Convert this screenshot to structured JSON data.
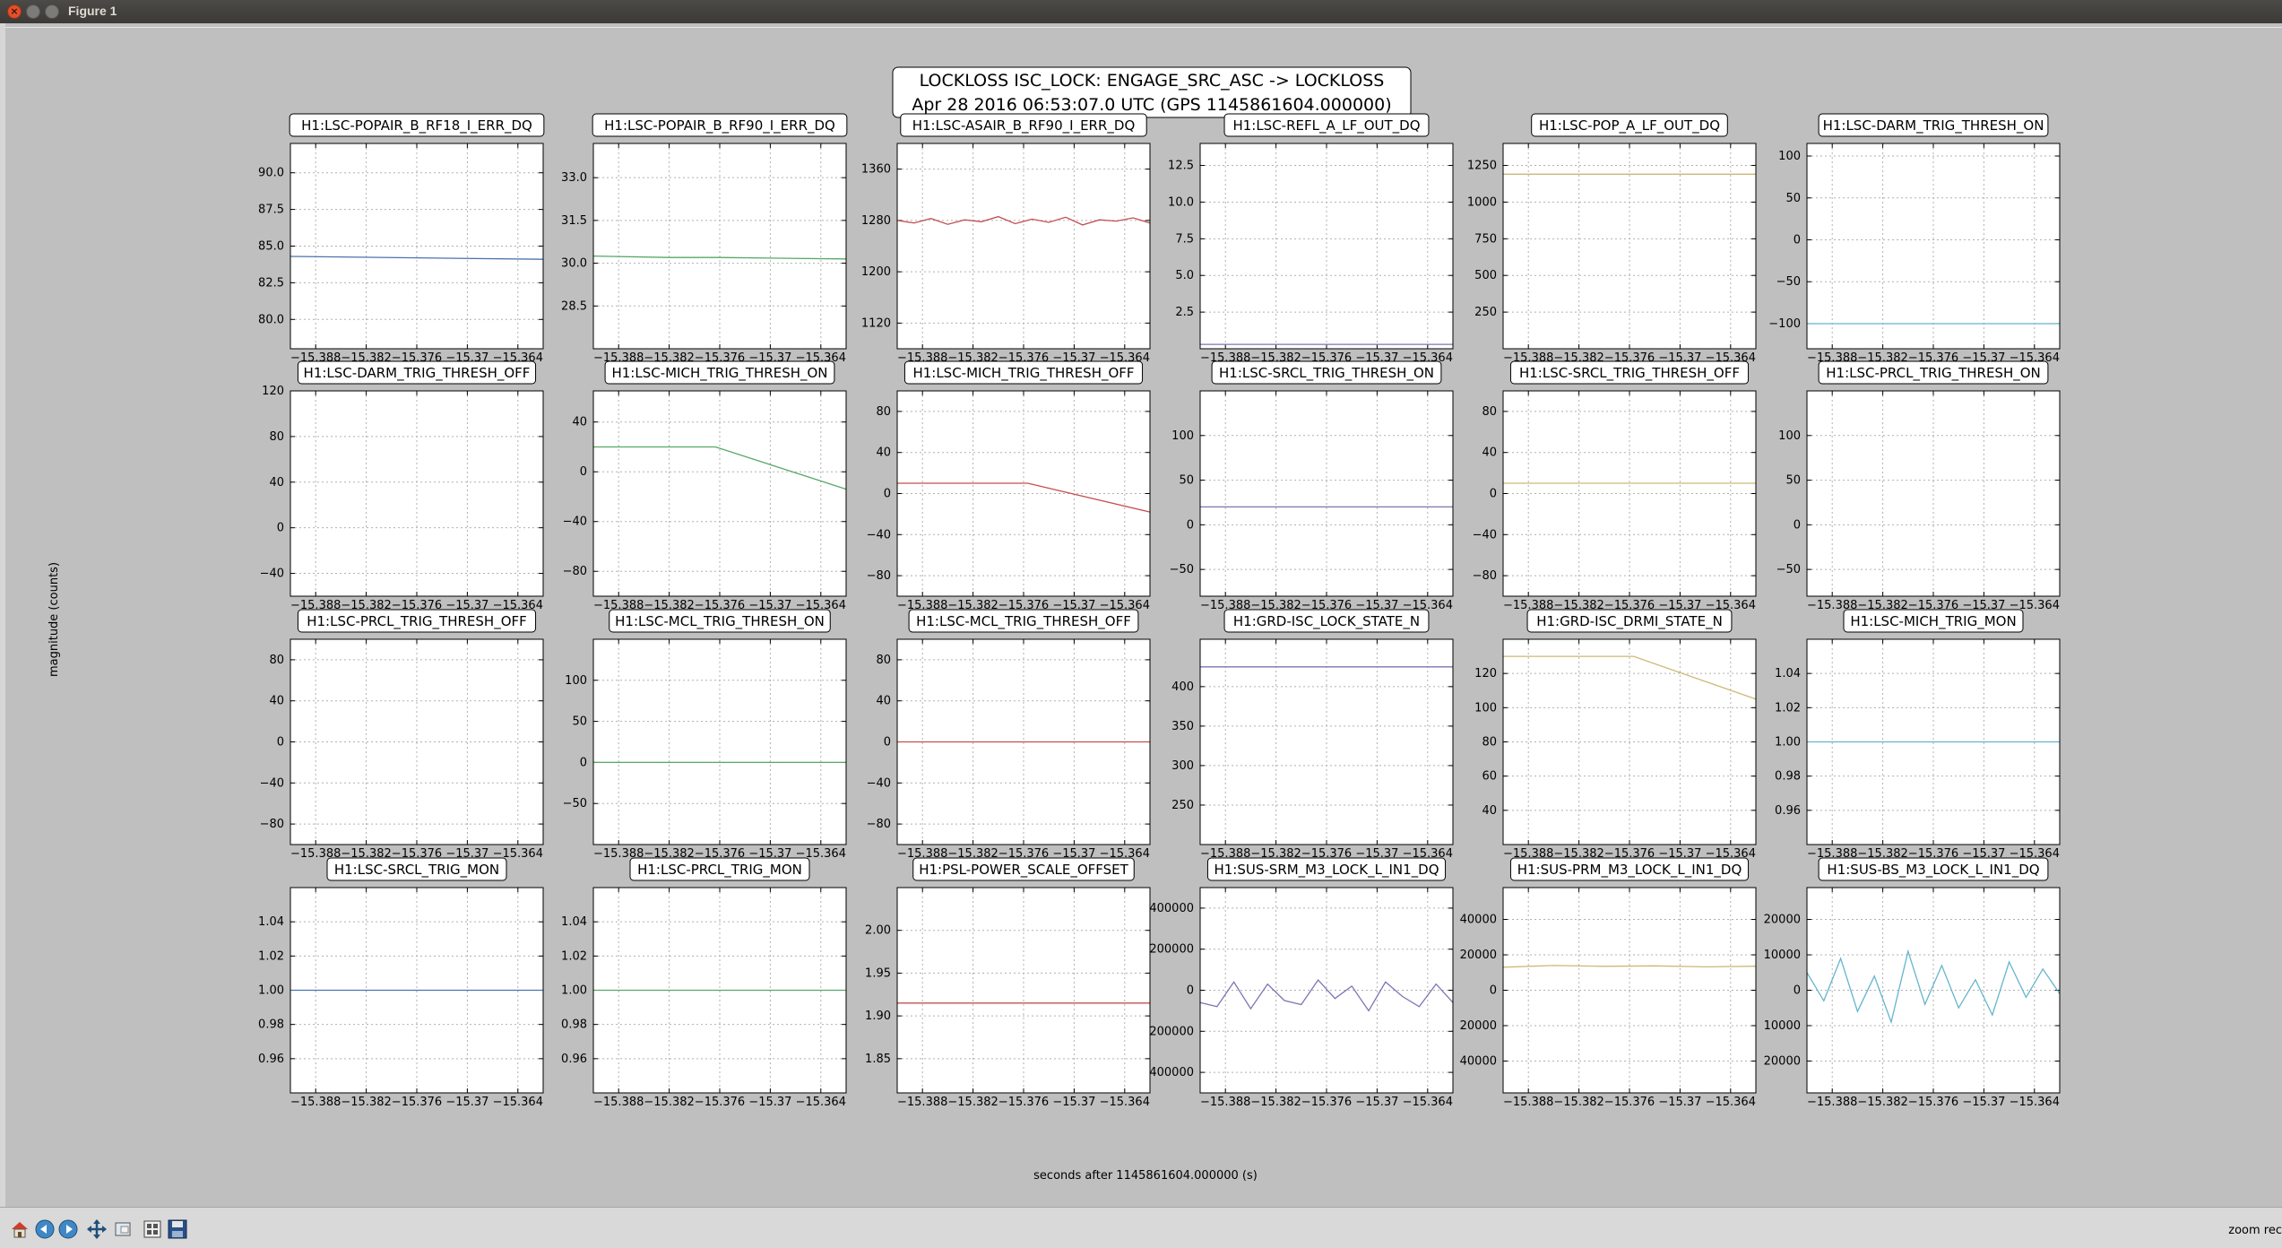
{
  "window": {
    "title": "Figure 1"
  },
  "figure": {
    "suptitle_line1": "LOCKLOSS ISC_LOCK: ENGAGE_SRC_ASC -> LOCKLOSS",
    "suptitle_line2": "Apr 28 2016 06:53:07.0 UTC (GPS 1145861604.000000)",
    "xlabel": "seconds after 1145861604.000000 (s)",
    "ylabel": "magnitude (counts)",
    "colors": [
      "#4c72b0",
      "#55a868",
      "#c44e52",
      "#8172b2",
      "#ccb974",
      "#64b5cd"
    ]
  },
  "chart_data": [
    {
      "type": "line",
      "title": "H1:LSC-POPAIR_B_RF18_I_ERR_DQ",
      "color": "#4c72b0",
      "xlim": [
        -15.391,
        -15.361
      ],
      "xticks": [
        "−15.388",
        "−15.382",
        "−15.376",
        "−15.37",
        "−15.364"
      ],
      "xtick_values": [
        -15.388,
        -15.382,
        -15.376,
        -15.37,
        -15.364
      ],
      "ylim": [
        78.0,
        92.0
      ],
      "yticks": [
        "80.0",
        "82.5",
        "85.0",
        "87.5",
        "90.0"
      ],
      "ytick_values": [
        80.0,
        82.5,
        85.0,
        87.5,
        90.0
      ],
      "x": [
        -15.391,
        -15.361
      ],
      "y": [
        84.3,
        84.1
      ]
    },
    {
      "type": "line",
      "title": "H1:LSC-POPAIR_B_RF90_I_ERR_DQ",
      "color": "#55a868",
      "xlim": [
        -15.391,
        -15.361
      ],
      "xticks": [
        "−15.388",
        "−15.382",
        "−15.376",
        "−15.37",
        "−15.364"
      ],
      "xtick_values": [
        -15.388,
        -15.382,
        -15.376,
        -15.37,
        -15.364
      ],
      "ylim": [
        27.0,
        34.2
      ],
      "yticks": [
        "28.5",
        "30.0",
        "31.5",
        "33.0"
      ],
      "ytick_values": [
        28.5,
        30.0,
        31.5,
        33.0
      ],
      "x": [
        -15.391,
        -15.382,
        -15.376,
        -15.37,
        -15.361
      ],
      "y": [
        30.25,
        30.2,
        30.2,
        30.18,
        30.15
      ]
    },
    {
      "type": "line",
      "title": "H1:LSC-ASAIR_B_RF90_I_ERR_DQ",
      "color": "#c44e52",
      "xlim": [
        -15.391,
        -15.361
      ],
      "xticks": [
        "−15.388",
        "−15.382",
        "−15.376",
        "−15.37",
        "−15.364"
      ],
      "xtick_values": [
        -15.388,
        -15.382,
        -15.376,
        -15.37,
        -15.364
      ],
      "ylim": [
        1080,
        1400
      ],
      "yticks": [
        "1120",
        "1200",
        "1280",
        "1360"
      ],
      "ytick_values": [
        1120,
        1200,
        1280,
        1360
      ],
      "x": [
        -15.391,
        -15.389,
        -15.387,
        -15.385,
        -15.383,
        -15.381,
        -15.379,
        -15.377,
        -15.375,
        -15.373,
        -15.371,
        -15.369,
        -15.367,
        -15.365,
        -15.363,
        -15.361
      ],
      "y": [
        1280,
        1276,
        1283,
        1274,
        1281,
        1278,
        1286,
        1275,
        1282,
        1277,
        1285,
        1273,
        1281,
        1279,
        1284,
        1276
      ]
    },
    {
      "type": "line",
      "title": "H1:LSC-REFL_A_LF_OUT_DQ",
      "color": "#8172b2",
      "xlim": [
        -15.391,
        -15.361
      ],
      "xticks": [
        "−15.388",
        "−15.382",
        "−15.376",
        "−15.37",
        "−15.364"
      ],
      "xtick_values": [
        -15.388,
        -15.382,
        -15.376,
        -15.37,
        -15.364
      ],
      "ylim": [
        0,
        14
      ],
      "yticks": [
        "2.5",
        "5.0",
        "7.5",
        "10.0",
        "12.5"
      ],
      "ytick_values": [
        2.5,
        5.0,
        7.5,
        10.0,
        12.5
      ],
      "x": [
        -15.391,
        -15.361
      ],
      "y": [
        0.3,
        0.3
      ]
    },
    {
      "type": "line",
      "title": "H1:LSC-POP_A_LF_OUT_DQ",
      "color": "#ccb974",
      "xlim": [
        -15.391,
        -15.361
      ],
      "xticks": [
        "−15.388",
        "−15.382",
        "−15.376",
        "−15.37",
        "−15.364"
      ],
      "xtick_values": [
        -15.388,
        -15.382,
        -15.376,
        -15.37,
        -15.364
      ],
      "ylim": [
        0,
        1400
      ],
      "yticks": [
        "250",
        "500",
        "750",
        "1000",
        "1250"
      ],
      "ytick_values": [
        250,
        500,
        750,
        1000,
        1250
      ],
      "x": [
        -15.391,
        -15.361
      ],
      "y": [
        1190,
        1190
      ]
    },
    {
      "type": "line",
      "title": "H1:LSC-DARM_TRIG_THRESH_ON",
      "color": "#64b5cd",
      "xlim": [
        -15.391,
        -15.361
      ],
      "xticks": [
        "−15.388",
        "−15.382",
        "−15.376",
        "−15.37",
        "−15.364"
      ],
      "xtick_values": [
        -15.388,
        -15.382,
        -15.376,
        -15.37,
        -15.364
      ],
      "ylim": [
        -130,
        115
      ],
      "yticks": [
        "−100",
        "−50",
        "0",
        "50",
        "100"
      ],
      "ytick_values": [
        -100,
        -50,
        0,
        50,
        100
      ],
      "x": [
        -15.391,
        -15.361
      ],
      "y": [
        -100,
        -100
      ]
    },
    {
      "type": "line",
      "title": "H1:LSC-DARM_TRIG_THRESH_OFF",
      "color": "#4c72b0",
      "xlim": [
        -15.391,
        -15.361
      ],
      "xticks": [
        "−15.388",
        "−15.382",
        "−15.376",
        "−15.37",
        "−15.364"
      ],
      "xtick_values": [
        -15.388,
        -15.382,
        -15.376,
        -15.37,
        -15.364
      ],
      "ylim": [
        -60,
        120
      ],
      "yticks": [
        "−40",
        "0",
        "40",
        "80",
        "120"
      ],
      "ytick_values": [
        -40,
        0,
        40,
        80,
        120
      ],
      "x": [],
      "y": []
    },
    {
      "type": "line",
      "title": "H1:LSC-MICH_TRIG_THRESH_ON",
      "color": "#55a868",
      "xlim": [
        -15.391,
        -15.361
      ],
      "xticks": [
        "−15.388",
        "−15.382",
        "−15.376",
        "−15.37",
        "−15.364"
      ],
      "xtick_values": [
        -15.388,
        -15.382,
        -15.376,
        -15.37,
        -15.364
      ],
      "ylim": [
        -100,
        65
      ],
      "yticks": [
        "−80",
        "−40",
        "0",
        "40"
      ],
      "ytick_values": [
        -80,
        -40,
        0,
        40
      ],
      "x": [
        -15.391,
        -15.3765,
        -15.361
      ],
      "y": [
        20,
        20,
        -14
      ]
    },
    {
      "type": "line",
      "title": "H1:LSC-MICH_TRIG_THRESH_OFF",
      "color": "#c44e52",
      "xlim": [
        -15.391,
        -15.361
      ],
      "xticks": [
        "−15.388",
        "−15.382",
        "−15.376",
        "−15.37",
        "−15.364"
      ],
      "xtick_values": [
        -15.388,
        -15.382,
        -15.376,
        -15.37,
        -15.364
      ],
      "ylim": [
        -100,
        100
      ],
      "yticks": [
        "−80",
        "−40",
        "0",
        "40",
        "80"
      ],
      "ytick_values": [
        -80,
        -40,
        0,
        40,
        80
      ],
      "x": [
        -15.391,
        -15.3755,
        -15.361
      ],
      "y": [
        10,
        10,
        -18
      ]
    },
    {
      "type": "line",
      "title": "H1:LSC-SRCL_TRIG_THRESH_ON",
      "color": "#8172b2",
      "xlim": [
        -15.391,
        -15.361
      ],
      "xticks": [
        "−15.388",
        "−15.382",
        "−15.376",
        "−15.37",
        "−15.364"
      ],
      "xtick_values": [
        -15.388,
        -15.382,
        -15.376,
        -15.37,
        -15.364
      ],
      "ylim": [
        -80,
        150
      ],
      "yticks": [
        "−50",
        "0",
        "50",
        "100"
      ],
      "ytick_values": [
        -50,
        0,
        50,
        100
      ],
      "x": [
        -15.391,
        -15.361
      ],
      "y": [
        20,
        20
      ]
    },
    {
      "type": "line",
      "title": "H1:LSC-SRCL_TRIG_THRESH_OFF",
      "color": "#ccb974",
      "xlim": [
        -15.391,
        -15.361
      ],
      "xticks": [
        "−15.388",
        "−15.382",
        "−15.376",
        "−15.37",
        "−15.364"
      ],
      "xtick_values": [
        -15.388,
        -15.382,
        -15.376,
        -15.37,
        -15.364
      ],
      "ylim": [
        -100,
        100
      ],
      "yticks": [
        "−80",
        "−40",
        "0",
        "40",
        "80"
      ],
      "ytick_values": [
        -80,
        -40,
        0,
        40,
        80
      ],
      "x": [
        -15.391,
        -15.361
      ],
      "y": [
        10,
        10
      ]
    },
    {
      "type": "line",
      "title": "H1:LSC-PRCL_TRIG_THRESH_ON",
      "color": "#64b5cd",
      "xlim": [
        -15.391,
        -15.361
      ],
      "xticks": [
        "−15.388",
        "−15.382",
        "−15.376",
        "−15.37",
        "−15.364"
      ],
      "xtick_values": [
        -15.388,
        -15.382,
        -15.376,
        -15.37,
        -15.364
      ],
      "ylim": [
        -80,
        150
      ],
      "yticks": [
        "−50",
        "0",
        "50",
        "100"
      ],
      "ytick_values": [
        -50,
        0,
        50,
        100
      ],
      "x": [],
      "y": []
    },
    {
      "type": "line",
      "title": "H1:LSC-PRCL_TRIG_THRESH_OFF",
      "color": "#4c72b0",
      "xlim": [
        -15.391,
        -15.361
      ],
      "xticks": [
        "−15.388",
        "−15.382",
        "−15.376",
        "−15.37",
        "−15.364"
      ],
      "xtick_values": [
        -15.388,
        -15.382,
        -15.376,
        -15.37,
        -15.364
      ],
      "ylim": [
        -100,
        100
      ],
      "yticks": [
        "−80",
        "−40",
        "0",
        "40",
        "80"
      ],
      "ytick_values": [
        -80,
        -40,
        0,
        40,
        80
      ],
      "x": [],
      "y": []
    },
    {
      "type": "line",
      "title": "H1:LSC-MCL_TRIG_THRESH_ON",
      "color": "#55a868",
      "xlim": [
        -15.391,
        -15.361
      ],
      "xticks": [
        "−15.388",
        "−15.382",
        "−15.376",
        "−15.37",
        "−15.364"
      ],
      "xtick_values": [
        -15.388,
        -15.382,
        -15.376,
        -15.37,
        -15.364
      ],
      "ylim": [
        -100,
        150
      ],
      "yticks": [
        "−50",
        "0",
        "50",
        "100"
      ],
      "ytick_values": [
        -50,
        0,
        50,
        100
      ],
      "x": [
        -15.391,
        -15.361
      ],
      "y": [
        0,
        0
      ]
    },
    {
      "type": "line",
      "title": "H1:LSC-MCL_TRIG_THRESH_OFF",
      "color": "#c44e52",
      "xlim": [
        -15.391,
        -15.361
      ],
      "xticks": [
        "−15.388",
        "−15.382",
        "−15.376",
        "−15.37",
        "−15.364"
      ],
      "xtick_values": [
        -15.388,
        -15.382,
        -15.376,
        -15.37,
        -15.364
      ],
      "ylim": [
        -100,
        100
      ],
      "yticks": [
        "−80",
        "−40",
        "0",
        "40",
        "80"
      ],
      "ytick_values": [
        -80,
        -40,
        0,
        40,
        80
      ],
      "x": [
        -15.391,
        -15.361
      ],
      "y": [
        0,
        0
      ]
    },
    {
      "type": "line",
      "title": "H1:GRD-ISC_LOCK_STATE_N",
      "color": "#8172b2",
      "xlim": [
        -15.391,
        -15.361
      ],
      "xticks": [
        "−15.388",
        "−15.382",
        "−15.376",
        "−15.37",
        "−15.364"
      ],
      "xtick_values": [
        -15.388,
        -15.382,
        -15.376,
        -15.37,
        -15.364
      ],
      "ylim": [
        200,
        460
      ],
      "yticks": [
        "250",
        "300",
        "350",
        "400"
      ],
      "ytick_values": [
        250,
        300,
        350,
        400
      ],
      "x": [
        -15.391,
        -15.361
      ],
      "y": [
        425,
        425
      ]
    },
    {
      "type": "line",
      "title": "H1:GRD-ISC_DRMI_STATE_N",
      "color": "#ccb974",
      "xlim": [
        -15.391,
        -15.361
      ],
      "xticks": [
        "−15.388",
        "−15.382",
        "−15.376",
        "−15.37",
        "−15.364"
      ],
      "xtick_values": [
        -15.388,
        -15.382,
        -15.376,
        -15.37,
        -15.364
      ],
      "ylim": [
        20,
        140
      ],
      "yticks": [
        "40",
        "60",
        "80",
        "100",
        "120"
      ],
      "ytick_values": [
        40,
        60,
        80,
        100,
        120
      ],
      "x": [
        -15.391,
        -15.3755,
        -15.361
      ],
      "y": [
        130,
        130,
        105
      ]
    },
    {
      "type": "line",
      "title": "H1:LSC-MICH_TRIG_MON",
      "color": "#64b5cd",
      "xlim": [
        -15.391,
        -15.361
      ],
      "xticks": [
        "−15.388",
        "−15.382",
        "−15.376",
        "−15.37",
        "−15.364"
      ],
      "xtick_values": [
        -15.388,
        -15.382,
        -15.376,
        -15.37,
        -15.364
      ],
      "ylim": [
        0.94,
        1.06
      ],
      "yticks": [
        "0.96",
        "0.98",
        "1.00",
        "1.02",
        "1.04"
      ],
      "ytick_values": [
        0.96,
        0.98,
        1.0,
        1.02,
        1.04
      ],
      "x": [
        -15.391,
        -15.361
      ],
      "y": [
        1.0,
        1.0
      ]
    },
    {
      "type": "line",
      "title": "H1:LSC-SRCL_TRIG_MON",
      "color": "#4c72b0",
      "xlim": [
        -15.391,
        -15.361
      ],
      "xticks": [
        "−15.388",
        "−15.382",
        "−15.376",
        "−15.37",
        "−15.364"
      ],
      "xtick_values": [
        -15.388,
        -15.382,
        -15.376,
        -15.37,
        -15.364
      ],
      "ylim": [
        0.94,
        1.06
      ],
      "yticks": [
        "0.96",
        "0.98",
        "1.00",
        "1.02",
        "1.04"
      ],
      "ytick_values": [
        0.96,
        0.98,
        1.0,
        1.02,
        1.04
      ],
      "x": [
        -15.391,
        -15.361
      ],
      "y": [
        1.0,
        1.0
      ]
    },
    {
      "type": "line",
      "title": "H1:LSC-PRCL_TRIG_MON",
      "color": "#55a868",
      "xlim": [
        -15.391,
        -15.361
      ],
      "xticks": [
        "−15.388",
        "−15.382",
        "−15.376",
        "−15.37",
        "−15.364"
      ],
      "xtick_values": [
        -15.388,
        -15.382,
        -15.376,
        -15.37,
        -15.364
      ],
      "ylim": [
        0.94,
        1.06
      ],
      "yticks": [
        "0.96",
        "0.98",
        "1.00",
        "1.02",
        "1.04"
      ],
      "ytick_values": [
        0.96,
        0.98,
        1.0,
        1.02,
        1.04
      ],
      "x": [
        -15.391,
        -15.361
      ],
      "y": [
        1.0,
        1.0
      ]
    },
    {
      "type": "line",
      "title": "H1:PSL-POWER_SCALE_OFFSET",
      "color": "#c44e52",
      "xlim": [
        -15.391,
        -15.361
      ],
      "xticks": [
        "−15.388",
        "−15.382",
        "−15.376",
        "−15.37",
        "−15.364"
      ],
      "xtick_values": [
        -15.388,
        -15.382,
        -15.376,
        -15.37,
        -15.364
      ],
      "ylim": [
        1.81,
        2.05
      ],
      "yticks": [
        "1.85",
        "1.90",
        "1.95",
        "2.00"
      ],
      "ytick_values": [
        1.85,
        1.9,
        1.95,
        2.0
      ],
      "x": [
        -15.391,
        -15.361
      ],
      "y": [
        1.915,
        1.915
      ]
    },
    {
      "type": "line",
      "title": "H1:SUS-SRM_M3_LOCK_L_IN1_DQ",
      "color": "#8172b2",
      "xlim": [
        -15.391,
        -15.361
      ],
      "xticks": [
        "−15.388",
        "−15.382",
        "−15.376",
        "−15.37",
        "−15.364"
      ],
      "xtick_values": [
        -15.388,
        -15.382,
        -15.376,
        -15.37,
        -15.364
      ],
      "ylim": [
        -500000,
        500000
      ],
      "yticks": [
        "400000",
        "200000",
        "0",
        "200000",
        "400000"
      ],
      "ytick_values": [
        -400000,
        -200000,
        0,
        200000,
        400000
      ],
      "x": [
        -15.391,
        -15.389,
        -15.387,
        -15.385,
        -15.383,
        -15.381,
        -15.379,
        -15.377,
        -15.375,
        -15.373,
        -15.371,
        -15.369,
        -15.367,
        -15.365,
        -15.363,
        -15.361
      ],
      "y": [
        -60000,
        -80000,
        40000,
        -90000,
        30000,
        -50000,
        -70000,
        50000,
        -40000,
        20000,
        -100000,
        40000,
        -30000,
        -80000,
        30000,
        -60000
      ]
    },
    {
      "type": "line",
      "title": "H1:SUS-PRM_M3_LOCK_L_IN1_DQ",
      "color": "#ccb974",
      "xlim": [
        -15.391,
        -15.361
      ],
      "xticks": [
        "−15.388",
        "−15.382",
        "−15.376",
        "−15.37",
        "−15.364"
      ],
      "xtick_values": [
        -15.388,
        -15.382,
        -15.376,
        -15.37,
        -15.364
      ],
      "ylim": [
        -58000,
        58000
      ],
      "yticks": [
        "40000",
        "20000",
        "0",
        "20000",
        "40000"
      ],
      "ytick_values": [
        -40000,
        -20000,
        0,
        20000,
        40000
      ],
      "x": [
        -15.391,
        -15.385,
        -15.379,
        -15.373,
        -15.367,
        -15.361
      ],
      "y": [
        13000,
        14000,
        13500,
        13800,
        13200,
        13600
      ]
    },
    {
      "type": "line",
      "title": "H1:SUS-BS_M3_LOCK_L_IN1_DQ",
      "color": "#64b5cd",
      "xlim": [
        -15.391,
        -15.361
      ],
      "xticks": [
        "−15.388",
        "−15.382",
        "−15.376",
        "−15.37",
        "−15.364"
      ],
      "xtick_values": [
        -15.388,
        -15.382,
        -15.376,
        -15.37,
        -15.364
      ],
      "ylim": [
        -29000,
        29000
      ],
      "yticks": [
        "20000",
        "10000",
        "0",
        "10000",
        "20000"
      ],
      "ytick_values": [
        -20000,
        -10000,
        0,
        10000,
        20000
      ],
      "x": [
        -15.391,
        -15.389,
        -15.387,
        -15.385,
        -15.383,
        -15.381,
        -15.379,
        -15.377,
        -15.375,
        -15.373,
        -15.371,
        -15.369,
        -15.367,
        -15.365,
        -15.363,
        -15.361
      ],
      "y": [
        5000,
        -3000,
        9000,
        -6000,
        4000,
        -9000,
        11000,
        -4000,
        7000,
        -5000,
        3000,
        -7000,
        8000,
        -2000,
        6000,
        -1000
      ]
    }
  ],
  "toolbar": {
    "buttons": [
      "home-icon",
      "back-icon",
      "forward-icon",
      "pan-icon",
      "zoom-icon",
      "subplots-icon",
      "save-icon"
    ],
    "status": "zoom rec"
  }
}
